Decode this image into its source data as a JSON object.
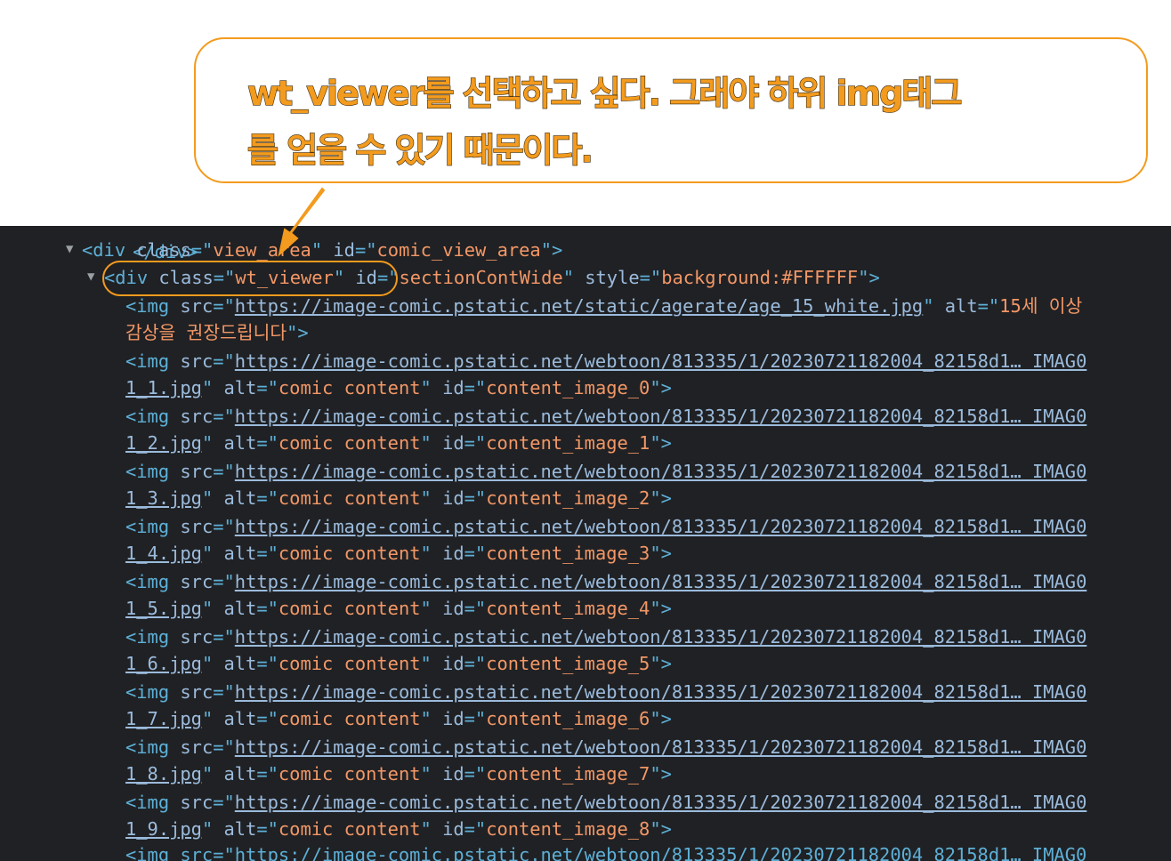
{
  "callout": {
    "line1": "wt_viewer를 선택하고 싶다. 그래야 하위 img태그",
    "line2": "를 얻을 수 있기 때문이다.",
    "accent": "#f39b1e"
  },
  "devtools": {
    "partial_top": "</div>",
    "view_area": {
      "tag_open": "<div",
      "class_attr": "class",
      "class_val": "view_area",
      "id_attr": "id",
      "id_val": "comic_view_area",
      "close": ">"
    },
    "wt_viewer": {
      "tag_open": "<div",
      "class_attr": "class",
      "class_val": "wt_viewer",
      "id_attr": "id",
      "id_val": "sectionContWide",
      "style_attr": "style",
      "style_val": "background:#FFFFFF",
      "close": ">"
    },
    "age_img": {
      "tag_open": "<img",
      "src_attr": "src",
      "src": "https://image-comic.pstatic.net/static/agerate/age_15_white.jpg",
      "alt_attr": "alt",
      "alt_part1": "15세 이상",
      "alt_part2": "감상을 권장드립니다",
      "close": ">"
    },
    "url_prefix": "https://image-comic.pstatic.net/webtoon/813335/1/20230721182004_82158d1… IMAG0",
    "alt_value": "comic content",
    "images": [
      {
        "file": "1_1.jpg",
        "id": "content_image_0"
      },
      {
        "file": "1_2.jpg",
        "id": "content_image_1"
      },
      {
        "file": "1_3.jpg",
        "id": "content_image_2"
      },
      {
        "file": "1_4.jpg",
        "id": "content_image_3"
      },
      {
        "file": "1_5.jpg",
        "id": "content_image_4"
      },
      {
        "file": "1_6.jpg",
        "id": "content_image_5"
      },
      {
        "file": "1_7.jpg",
        "id": "content_image_6"
      },
      {
        "file": "1_8.jpg",
        "id": "content_image_7"
      },
      {
        "file": "1_9.jpg",
        "id": "content_image_8"
      }
    ],
    "partial_bottom": "<img src=\"https://image-comic.pstatic.net/webtoon/813335/1/20230721182004_82158d1… IMAG0"
  }
}
